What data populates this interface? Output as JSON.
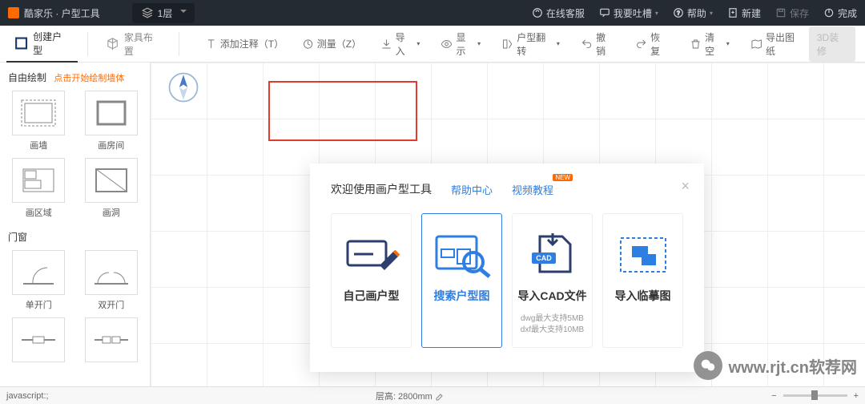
{
  "header": {
    "brand": "酷家乐 · 户型工具",
    "floor": "1层",
    "service": "在线客服",
    "feedback": "我要吐槽",
    "help": "帮助",
    "new": "新建",
    "save": "保存",
    "done": "完成"
  },
  "toolbar": {
    "tab_create": "创建户型",
    "tab_furniture": "家具布置",
    "annotate": "添加注释（T）",
    "measure": "测量（Z）",
    "import": "导入",
    "display": "显示",
    "flip": "户型翻转",
    "undo": "撤销",
    "redo": "恢复",
    "clear": "清空",
    "export_dwg": "导出图纸",
    "btn3d": "3D装修"
  },
  "sidebar": {
    "free_draw": "自由绘制",
    "free_hint": "点击开始绘制墙体",
    "items_a": [
      "画墙",
      "画房间",
      "画区域",
      "画洞"
    ],
    "doors_title": "门窗",
    "items_b": [
      "单开门",
      "双开门"
    ]
  },
  "modal": {
    "title": "欢迎使用画户型工具",
    "help_center": "帮助中心",
    "video_tut": "视频教程",
    "badge": "NEW",
    "cards": [
      {
        "title": "自己画户型",
        "sub": ""
      },
      {
        "title": "搜索户型图",
        "sub": ""
      },
      {
        "title": "导入CAD文件",
        "sub": "dwg最大支持5MB\ndxf最大支持10MB"
      },
      {
        "title": "导入临摹图",
        "sub": ""
      }
    ]
  },
  "status": {
    "js": "javascript:;",
    "floor_h_label": "层高:",
    "floor_h_val": "2800mm"
  },
  "watermark": "www.rjt.cn软荐网"
}
